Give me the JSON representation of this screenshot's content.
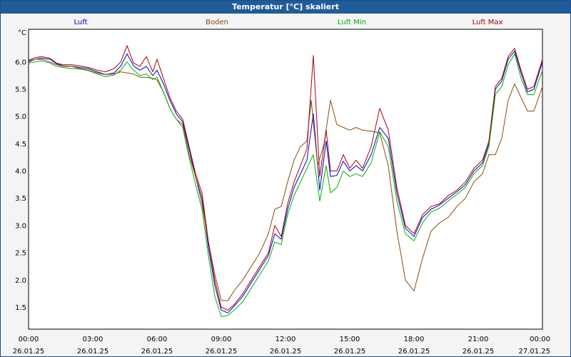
{
  "window": {
    "title": "Temperatur [°C] skaliert"
  },
  "chart_data": {
    "type": "line",
    "title": "Temperatur [°C] skaliert",
    "ylabel": "°C",
    "xlabel": "",
    "ylim": [
      1.1,
      6.6
    ],
    "yticks": [
      1.5,
      2.0,
      2.5,
      3.0,
      3.5,
      4.0,
      4.5,
      5.0,
      5.5,
      6.0
    ],
    "xlim": [
      0,
      24
    ],
    "xticks": [
      {
        "t": 0,
        "time": "00:00",
        "date": "26.01.25"
      },
      {
        "t": 3,
        "time": "03:00",
        "date": "26.01.25"
      },
      {
        "t": 6,
        "time": "06:00",
        "date": "26.01.25"
      },
      {
        "t": 9,
        "time": "09:00",
        "date": "26.01.25"
      },
      {
        "t": 12,
        "time": "12:00",
        "date": "26.01.25"
      },
      {
        "t": 15,
        "time": "15:00",
        "date": "26.01.25"
      },
      {
        "t": 18,
        "time": "18:00",
        "date": "26.01.25"
      },
      {
        "t": 21,
        "time": "21:00",
        "date": "26.01.25"
      },
      {
        "t": 24,
        "time": "00:00",
        "date": "27.01.25"
      }
    ],
    "grid": true,
    "legend_position": "top",
    "series": [
      {
        "name": "Luft",
        "color": "#0000cc",
        "points": [
          [
            0,
            6.0
          ],
          [
            0.3,
            6.05
          ],
          [
            0.6,
            6.07
          ],
          [
            1.0,
            6.05
          ],
          [
            1.3,
            5.97
          ],
          [
            1.6,
            5.93
          ],
          [
            2.0,
            5.92
          ],
          [
            2.4,
            5.9
          ],
          [
            2.8,
            5.88
          ],
          [
            3.2,
            5.82
          ],
          [
            3.6,
            5.77
          ],
          [
            4.0,
            5.8
          ],
          [
            4.3,
            5.92
          ],
          [
            4.6,
            6.15
          ],
          [
            4.9,
            5.93
          ],
          [
            5.2,
            5.85
          ],
          [
            5.5,
            5.92
          ],
          [
            5.8,
            5.75
          ],
          [
            6.0,
            5.85
          ],
          [
            6.3,
            5.6
          ],
          [
            6.6,
            5.3
          ],
          [
            6.9,
            5.05
          ],
          [
            7.2,
            4.9
          ],
          [
            7.5,
            4.4
          ],
          [
            7.8,
            3.9
          ],
          [
            8.1,
            3.5
          ],
          [
            8.4,
            2.6
          ],
          [
            8.7,
            1.9
          ],
          [
            9.0,
            1.45
          ],
          [
            9.3,
            1.4
          ],
          [
            9.6,
            1.52
          ],
          [
            10.0,
            1.7
          ],
          [
            10.4,
            1.95
          ],
          [
            10.8,
            2.2
          ],
          [
            11.2,
            2.45
          ],
          [
            11.5,
            2.85
          ],
          [
            11.8,
            2.75
          ],
          [
            12.1,
            3.3
          ],
          [
            12.4,
            3.7
          ],
          [
            12.7,
            3.95
          ],
          [
            13.0,
            4.2
          ],
          [
            13.3,
            5.05
          ],
          [
            13.6,
            3.65
          ],
          [
            13.9,
            4.55
          ],
          [
            14.1,
            3.9
          ],
          [
            14.4,
            3.92
          ],
          [
            14.7,
            4.18
          ],
          [
            15.0,
            4.0
          ],
          [
            15.3,
            4.1
          ],
          [
            15.6,
            4.0
          ],
          [
            16.0,
            4.3
          ],
          [
            16.4,
            4.8
          ],
          [
            16.8,
            4.6
          ],
          [
            17.2,
            3.6
          ],
          [
            17.6,
            2.95
          ],
          [
            18.0,
            2.8
          ],
          [
            18.4,
            3.15
          ],
          [
            18.8,
            3.3
          ],
          [
            19.2,
            3.38
          ],
          [
            19.6,
            3.5
          ],
          [
            20.0,
            3.62
          ],
          [
            20.4,
            3.75
          ],
          [
            20.8,
            4.0
          ],
          [
            21.2,
            4.15
          ],
          [
            21.5,
            4.5
          ],
          [
            21.8,
            5.5
          ],
          [
            22.1,
            5.65
          ],
          [
            22.4,
            6.05
          ],
          [
            22.7,
            6.2
          ],
          [
            23.0,
            5.8
          ],
          [
            23.3,
            5.45
          ],
          [
            23.6,
            5.5
          ],
          [
            24.0,
            6.0
          ]
        ]
      },
      {
        "name": "Boden",
        "color": "#8b4a0b",
        "points": [
          [
            0,
            6.02
          ],
          [
            0.3,
            6.05
          ],
          [
            0.6,
            6.05
          ],
          [
            1.0,
            6.0
          ],
          [
            1.3,
            5.95
          ],
          [
            1.6,
            5.92
          ],
          [
            2.0,
            5.92
          ],
          [
            2.4,
            5.88
          ],
          [
            2.8,
            5.85
          ],
          [
            3.2,
            5.8
          ],
          [
            3.6,
            5.77
          ],
          [
            4.0,
            5.78
          ],
          [
            4.3,
            5.82
          ],
          [
            4.6,
            5.8
          ],
          [
            4.9,
            5.78
          ],
          [
            5.2,
            5.72
          ],
          [
            5.5,
            5.72
          ],
          [
            5.8,
            5.7
          ],
          [
            6.0,
            5.67
          ],
          [
            6.3,
            5.45
          ],
          [
            6.6,
            5.15
          ],
          [
            6.9,
            4.95
          ],
          [
            7.2,
            4.85
          ],
          [
            7.5,
            4.3
          ],
          [
            7.8,
            3.9
          ],
          [
            8.1,
            3.4
          ],
          [
            8.4,
            2.7
          ],
          [
            8.7,
            2.1
          ],
          [
            9.0,
            1.63
          ],
          [
            9.3,
            1.62
          ],
          [
            9.6,
            1.8
          ],
          [
            10.0,
            2.0
          ],
          [
            10.4,
            2.25
          ],
          [
            10.8,
            2.5
          ],
          [
            11.2,
            2.85
          ],
          [
            11.5,
            3.3
          ],
          [
            11.8,
            3.35
          ],
          [
            12.1,
            3.8
          ],
          [
            12.4,
            4.2
          ],
          [
            12.7,
            4.45
          ],
          [
            13.0,
            4.55
          ],
          [
            13.2,
            5.3
          ],
          [
            13.5,
            4.1
          ],
          [
            13.8,
            4.5
          ],
          [
            14.1,
            5.3
          ],
          [
            14.4,
            4.85
          ],
          [
            14.7,
            4.8
          ],
          [
            15.0,
            4.75
          ],
          [
            15.3,
            4.8
          ],
          [
            15.6,
            4.75
          ],
          [
            16.0,
            4.73
          ],
          [
            16.4,
            4.7
          ],
          [
            16.8,
            4.1
          ],
          [
            17.2,
            2.9
          ],
          [
            17.6,
            2.0
          ],
          [
            18.0,
            1.8
          ],
          [
            18.4,
            2.4
          ],
          [
            18.8,
            2.9
          ],
          [
            19.2,
            3.05
          ],
          [
            19.6,
            3.15
          ],
          [
            20.0,
            3.35
          ],
          [
            20.4,
            3.5
          ],
          [
            20.8,
            3.8
          ],
          [
            21.2,
            3.95
          ],
          [
            21.5,
            4.3
          ],
          [
            21.8,
            4.3
          ],
          [
            22.1,
            4.6
          ],
          [
            22.4,
            5.3
          ],
          [
            22.7,
            5.6
          ],
          [
            23.0,
            5.35
          ],
          [
            23.3,
            5.1
          ],
          [
            23.6,
            5.1
          ],
          [
            24.0,
            5.55
          ]
        ]
      },
      {
        "name": "Luft Min",
        "color": "#00b000",
        "points": [
          [
            0,
            5.98
          ],
          [
            0.3,
            6.0
          ],
          [
            0.6,
            6.02
          ],
          [
            1.0,
            5.98
          ],
          [
            1.3,
            5.92
          ],
          [
            1.6,
            5.9
          ],
          [
            2.0,
            5.88
          ],
          [
            2.4,
            5.87
          ],
          [
            2.8,
            5.84
          ],
          [
            3.2,
            5.78
          ],
          [
            3.6,
            5.73
          ],
          [
            4.0,
            5.76
          ],
          [
            4.3,
            5.85
          ],
          [
            4.6,
            6.0
          ],
          [
            4.9,
            5.85
          ],
          [
            5.2,
            5.75
          ],
          [
            5.5,
            5.78
          ],
          [
            5.8,
            5.68
          ],
          [
            6.0,
            5.72
          ],
          [
            6.3,
            5.45
          ],
          [
            6.6,
            5.15
          ],
          [
            6.9,
            4.95
          ],
          [
            7.2,
            4.8
          ],
          [
            7.5,
            4.25
          ],
          [
            7.8,
            3.75
          ],
          [
            8.1,
            3.3
          ],
          [
            8.4,
            2.45
          ],
          [
            8.7,
            1.7
          ],
          [
            9.0,
            1.33
          ],
          [
            9.3,
            1.35
          ],
          [
            9.6,
            1.45
          ],
          [
            10.0,
            1.6
          ],
          [
            10.4,
            1.85
          ],
          [
            10.8,
            2.1
          ],
          [
            11.2,
            2.35
          ],
          [
            11.5,
            2.7
          ],
          [
            11.8,
            2.65
          ],
          [
            12.1,
            3.2
          ],
          [
            12.4,
            3.55
          ],
          [
            12.7,
            3.8
          ],
          [
            13.0,
            4.05
          ],
          [
            13.3,
            4.3
          ],
          [
            13.6,
            3.45
          ],
          [
            13.9,
            4.1
          ],
          [
            14.1,
            3.6
          ],
          [
            14.4,
            3.7
          ],
          [
            14.7,
            4.0
          ],
          [
            15.0,
            3.9
          ],
          [
            15.3,
            3.95
          ],
          [
            15.6,
            3.9
          ],
          [
            16.0,
            4.15
          ],
          [
            16.4,
            4.72
          ],
          [
            16.8,
            4.45
          ],
          [
            17.2,
            3.45
          ],
          [
            17.6,
            2.85
          ],
          [
            18.0,
            2.72
          ],
          [
            18.4,
            3.05
          ],
          [
            18.8,
            3.25
          ],
          [
            19.2,
            3.32
          ],
          [
            19.6,
            3.45
          ],
          [
            20.0,
            3.57
          ],
          [
            20.4,
            3.7
          ],
          [
            20.8,
            3.95
          ],
          [
            21.2,
            4.1
          ],
          [
            21.5,
            4.45
          ],
          [
            21.8,
            5.4
          ],
          [
            22.1,
            5.55
          ],
          [
            22.4,
            5.95
          ],
          [
            22.7,
            6.15
          ],
          [
            23.0,
            5.7
          ],
          [
            23.3,
            5.4
          ],
          [
            23.6,
            5.4
          ],
          [
            24.0,
            5.85
          ]
        ]
      },
      {
        "name": "Luft Max",
        "color": "#aa0000",
        "points": [
          [
            0,
            6.03
          ],
          [
            0.3,
            6.08
          ],
          [
            0.6,
            6.1
          ],
          [
            1.0,
            6.07
          ],
          [
            1.3,
            5.98
          ],
          [
            1.6,
            5.95
          ],
          [
            2.0,
            5.95
          ],
          [
            2.4,
            5.93
          ],
          [
            2.8,
            5.9
          ],
          [
            3.2,
            5.85
          ],
          [
            3.6,
            5.82
          ],
          [
            4.0,
            5.88
          ],
          [
            4.3,
            6.0
          ],
          [
            4.6,
            6.3
          ],
          [
            4.9,
            5.98
          ],
          [
            5.2,
            5.92
          ],
          [
            5.5,
            6.1
          ],
          [
            5.8,
            5.82
          ],
          [
            6.0,
            6.05
          ],
          [
            6.3,
            5.7
          ],
          [
            6.6,
            5.35
          ],
          [
            6.9,
            5.1
          ],
          [
            7.2,
            4.95
          ],
          [
            7.5,
            4.45
          ],
          [
            7.8,
            3.95
          ],
          [
            8.1,
            3.6
          ],
          [
            8.4,
            2.7
          ],
          [
            8.7,
            2.0
          ],
          [
            9.0,
            1.5
          ],
          [
            9.3,
            1.45
          ],
          [
            9.6,
            1.55
          ],
          [
            10.0,
            1.75
          ],
          [
            10.4,
            2.0
          ],
          [
            10.8,
            2.25
          ],
          [
            11.2,
            2.5
          ],
          [
            11.5,
            3.0
          ],
          [
            11.8,
            2.8
          ],
          [
            12.1,
            3.4
          ],
          [
            12.4,
            3.8
          ],
          [
            12.7,
            4.1
          ],
          [
            13.0,
            4.4
          ],
          [
            13.3,
            6.12
          ],
          [
            13.6,
            3.9
          ],
          [
            13.9,
            4.75
          ],
          [
            14.1,
            4.0
          ],
          [
            14.4,
            4.0
          ],
          [
            14.7,
            4.3
          ],
          [
            15.0,
            4.05
          ],
          [
            15.3,
            4.2
          ],
          [
            15.6,
            4.05
          ],
          [
            16.0,
            4.45
          ],
          [
            16.4,
            5.15
          ],
          [
            16.8,
            4.75
          ],
          [
            17.2,
            3.7
          ],
          [
            17.6,
            3.0
          ],
          [
            18.0,
            2.85
          ],
          [
            18.4,
            3.2
          ],
          [
            18.8,
            3.35
          ],
          [
            19.2,
            3.4
          ],
          [
            19.6,
            3.55
          ],
          [
            20.0,
            3.65
          ],
          [
            20.4,
            3.8
          ],
          [
            20.8,
            4.05
          ],
          [
            21.2,
            4.2
          ],
          [
            21.5,
            4.55
          ],
          [
            21.8,
            5.55
          ],
          [
            22.1,
            5.7
          ],
          [
            22.4,
            6.1
          ],
          [
            22.7,
            6.25
          ],
          [
            23.0,
            5.85
          ],
          [
            23.3,
            5.5
          ],
          [
            23.6,
            5.55
          ],
          [
            24.0,
            6.05
          ]
        ]
      }
    ]
  }
}
